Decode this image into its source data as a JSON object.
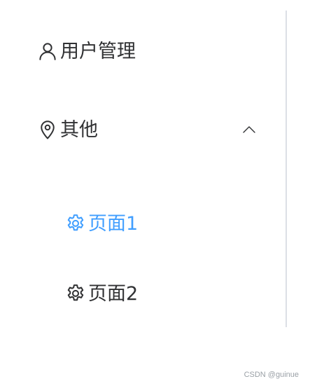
{
  "menu": {
    "items": [
      {
        "label": "用户管理",
        "icon": "user-icon"
      },
      {
        "label": "其他",
        "icon": "location-icon",
        "expanded": true,
        "children": [
          {
            "label": "页面1",
            "icon": "gear-icon",
            "active": true
          },
          {
            "label": "页面2",
            "icon": "gear-icon",
            "active": false
          }
        ]
      }
    ]
  },
  "colors": {
    "text": "#303133",
    "active": "#409eff",
    "border": "#dcdfe6",
    "watermark": "#9aa0a6"
  },
  "watermark": "CSDN @guinue"
}
